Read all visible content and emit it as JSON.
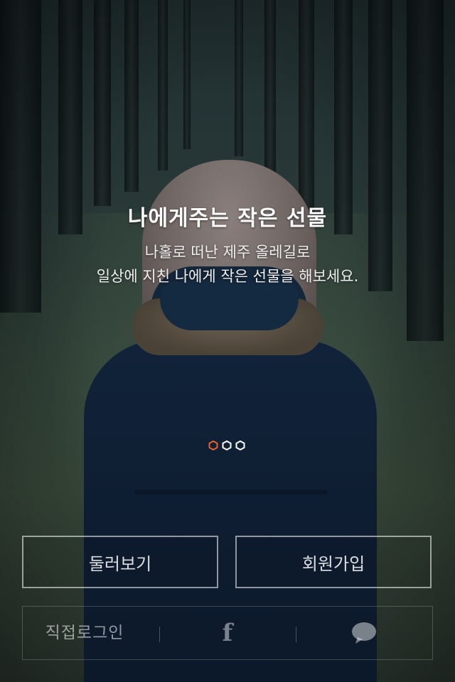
{
  "intro": {
    "headline": "나에게주는 작은 선물",
    "subline_1": "나홀로 떠난 제주 올레길로",
    "subline_2": "일상에 지친 나에게 작은 선물을 해보세요."
  },
  "pager": {
    "total": 3,
    "active_index": 0,
    "active_color": "#e8612c",
    "inactive_color": "#ffffff"
  },
  "actions": {
    "browse_label": "둘러보기",
    "signup_label": "회원가입"
  },
  "login": {
    "direct_label": "직접로그인",
    "facebook_icon": "facebook-icon",
    "talk_icon": "speech-bubble-icon"
  }
}
